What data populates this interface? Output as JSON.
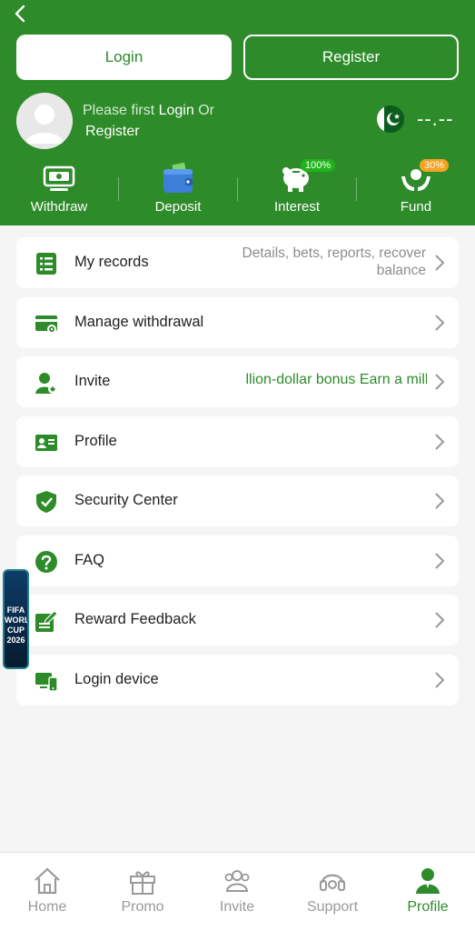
{
  "header": {
    "login_button": "Login",
    "register_button": "Register",
    "hint_prefix": "Please first",
    "hint_login": "Login",
    "hint_or": "Or",
    "hint_register": "Register",
    "balance": "--.--"
  },
  "quick_actions": [
    {
      "label": "Withdraw"
    },
    {
      "label": "Deposit"
    },
    {
      "label": "Interest",
      "badge": "100%"
    },
    {
      "label": "Fund",
      "badge": "30%"
    }
  ],
  "menu": [
    {
      "label": "My records",
      "desc": "Details, bets, reports, recover balance"
    },
    {
      "label": "Manage withdrawal"
    },
    {
      "label": "Invite",
      "marquee": "Earn a million-dollar bonus  Earn a milli"
    },
    {
      "label": "Profile"
    },
    {
      "label": "Security Center"
    },
    {
      "label": "FAQ"
    },
    {
      "label": "Reward Feedback"
    },
    {
      "label": "Login device"
    }
  ],
  "floating_banner": {
    "text": "FIFA WORLD CUP 2026"
  },
  "bottom_nav": [
    {
      "label": "Home"
    },
    {
      "label": "Promo"
    },
    {
      "label": "Invite"
    },
    {
      "label": "Support"
    },
    {
      "label": "Profile",
      "active": true
    }
  ],
  "colors": {
    "primary": "#2e8b2a",
    "background": "#f5f5f5",
    "badge_green": "#20b41b",
    "badge_orange": "#f4a321"
  }
}
